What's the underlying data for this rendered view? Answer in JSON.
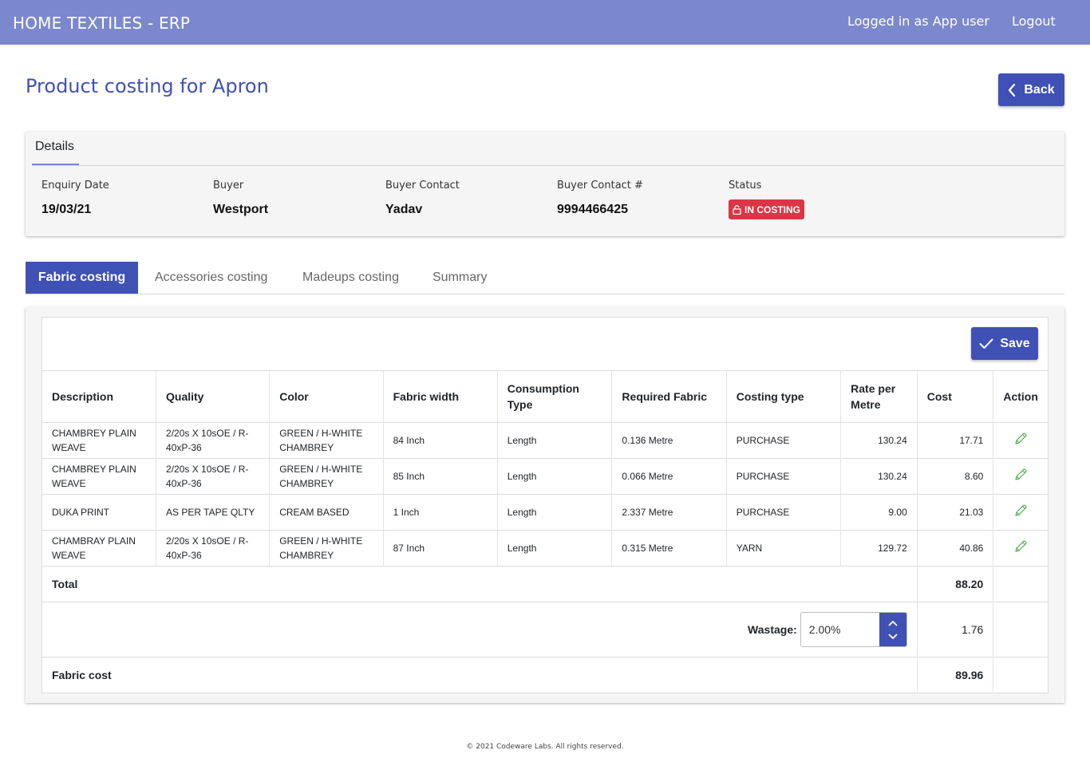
{
  "header": {
    "app_title": "HOME TEXTILES - ERP",
    "user_text": "Logged in as App user",
    "logout_label": "Logout"
  },
  "page": {
    "title": "Product costing for Apron",
    "back_label": "Back"
  },
  "details": {
    "tab_label": "Details",
    "fields": [
      {
        "label": "Enquiry Date",
        "value": "19/03/21"
      },
      {
        "label": "Buyer",
        "value": "Westport"
      },
      {
        "label": "Buyer Contact",
        "value": "Yadav"
      },
      {
        "label": "Buyer Contact #",
        "value": "9994466425"
      }
    ],
    "status_label": "Status",
    "status_value": "IN COSTING",
    "status_color": "#dc3545"
  },
  "tabs": [
    {
      "label": "Fabric costing",
      "active": true
    },
    {
      "label": "Accessories costing",
      "active": false
    },
    {
      "label": "Madeups costing",
      "active": false
    },
    {
      "label": "Summary",
      "active": false
    }
  ],
  "fabric": {
    "save_label": "Save",
    "columns": [
      "Description",
      "Quality",
      "Color",
      "Fabric width",
      "Consumption Type",
      "Required Fabric",
      "Costing type",
      "Rate per Metre",
      "Cost",
      "Action"
    ],
    "rows": [
      {
        "description": "CHAMBREY PLAIN WEAVE",
        "quality": "2/20s X 10sOE / R-40xP-36",
        "color": "GREEN / H-WHITE CHAMBREY",
        "width": "84 Inch",
        "consumption": "Length",
        "required": "0.136 Metre",
        "costing_type": "PURCHASE",
        "rate": "130.24",
        "cost": "17.71",
        "action_icon": "pencil-icon"
      },
      {
        "description": "CHAMBREY PLAIN WEAVE",
        "quality": "2/20s X 10sOE / R-40xP-36",
        "color": "GREEN / H-WHITE CHAMBREY",
        "width": "85 Inch",
        "consumption": "Length",
        "required": "0.066 Metre",
        "costing_type": "PURCHASE",
        "rate": "130.24",
        "cost": "8.60",
        "action_icon": "pencil-icon"
      },
      {
        "description": "DUKA PRINT",
        "quality": "AS PER TAPE QLTY",
        "color": "CREAM BASED",
        "width": "1 Inch",
        "consumption": "Length",
        "required": "2.337 Metre",
        "costing_type": "PURCHASE",
        "rate": "9.00",
        "cost": "21.03",
        "action_icon": "pencil-icon"
      },
      {
        "description": "CHAMBRAY PLAIN WEAVE",
        "quality": "2/20s X 10sOE / R-40xP-36",
        "color": "GREEN / H-WHITE CHAMBREY",
        "width": "87 Inch",
        "consumption": "Length",
        "required": "0.315 Metre",
        "costing_type": "YARN",
        "rate": "129.72",
        "cost": "40.86",
        "action_icon": "pencil-icon"
      }
    ],
    "total_label": "Total",
    "total_value": "88.20",
    "wastage_label": "Wastage:",
    "wastage_value": "2.00%",
    "wastage_cost": "1.76",
    "fabric_cost_label": "Fabric cost",
    "fabric_cost_value": "89.96"
  },
  "footer": {
    "text": "© 2021 Codeware Labs. All rights reserved."
  },
  "colors": {
    "header_bg": "#7b88cd",
    "primary": "#3f51b5",
    "edit_icon": "#4caf50"
  }
}
